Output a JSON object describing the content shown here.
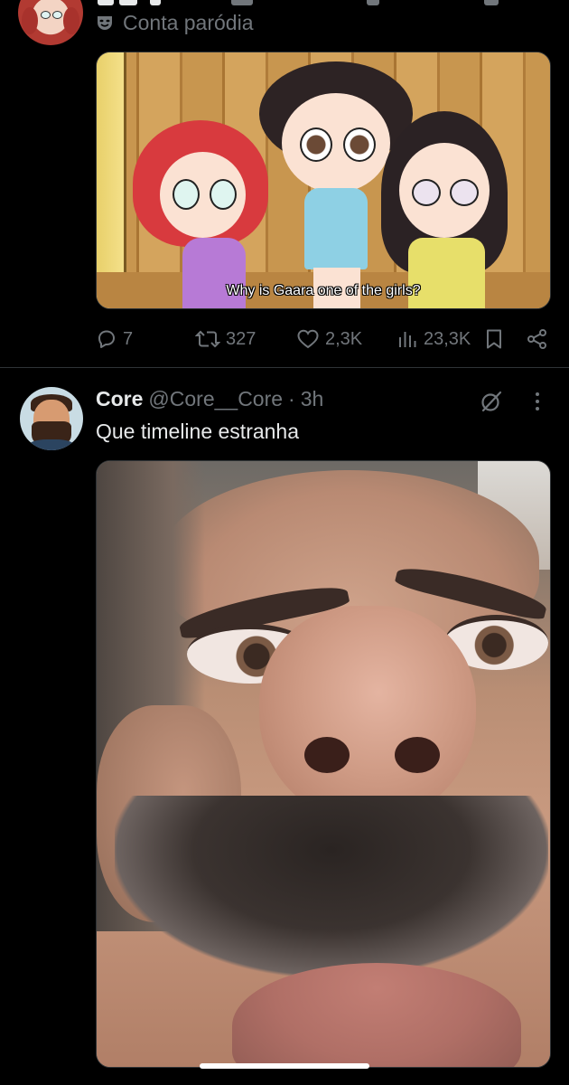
{
  "tweet_top": {
    "label": "Conta paródia",
    "label_icon": "parody-mask-icon",
    "media": {
      "subtitle": "Why is Gaara one of the girls?"
    },
    "actions": {
      "replies": "7",
      "reposts": "327",
      "likes": "2,3K",
      "views": "23,3K"
    }
  },
  "tweet_main": {
    "display_name": "Core",
    "handle": "@Core__Core",
    "separator": "·",
    "time": "3h",
    "text": "Que timeline estranha",
    "icons": [
      "grok-icon",
      "more-options-icon"
    ]
  },
  "colors": {
    "background": "#000000",
    "primary_text": "#e7e9ea",
    "secondary_text": "#71767b",
    "divider": "#2f3336"
  }
}
